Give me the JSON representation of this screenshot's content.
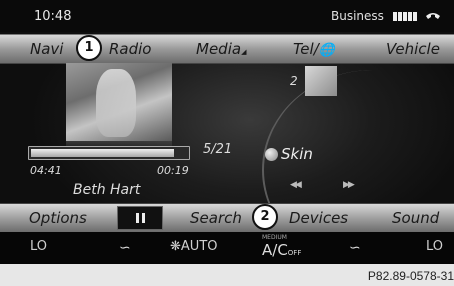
{
  "status": {
    "time": "10:48",
    "network": "Business"
  },
  "menu": {
    "navi": "Navi",
    "radio": "Radio",
    "media": "Media",
    "tel": "Tel/",
    "vehicle": "Vehicle"
  },
  "callouts": {
    "one": "1",
    "two": "2"
  },
  "player": {
    "next_track_number": "2",
    "track_count": "5/21",
    "elapsed": "04:41",
    "remaining": "00:19",
    "progress_fraction": 0.93,
    "artist": "Beth Hart",
    "skin_label": "Skin"
  },
  "bottom": {
    "options": "Options",
    "search": "Search",
    "devices": "Devices",
    "sound": "Sound"
  },
  "climate": {
    "left_temp": "LO",
    "fan": "AUTO",
    "ac_medium": "MEDIUM",
    "ac_main": "A/C",
    "ac_off": "OFF",
    "right_temp": "LO"
  },
  "figure_ref": "P82.89-0578-31",
  "icons": [
    "signal-bars-icon",
    "phone-icon",
    "globe-icon",
    "pause-icon",
    "skip-back-icon",
    "skip-forward-icon",
    "seat-heat-left-icon",
    "fan-icon",
    "seat-heat-right-icon"
  ]
}
